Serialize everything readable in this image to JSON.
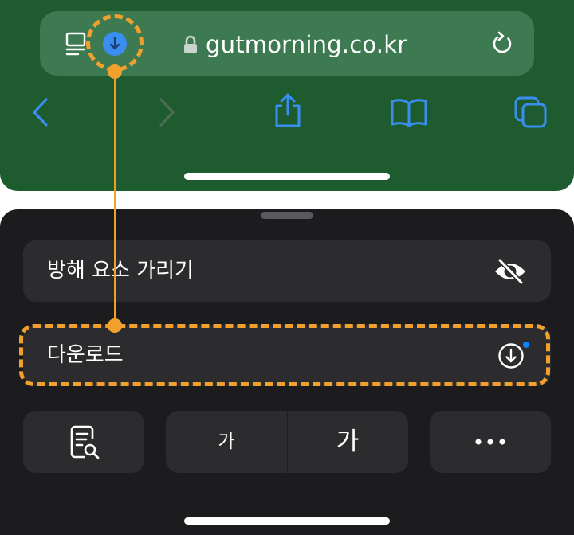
{
  "browser": {
    "url": "gutmorning.co.kr",
    "reader_icon": "page-menu-icon",
    "download_icon": "download-arrow-icon",
    "lock_icon": "lock-icon",
    "reload_icon": "reload-icon"
  },
  "toolbar": {
    "items": [
      "back-icon",
      "forward-icon",
      "share-icon",
      "bookmarks-icon",
      "tabs-icon"
    ]
  },
  "menu": {
    "hide_distracting_items": {
      "label": "방해 요소 가리기",
      "icon": "eye-slash-icon"
    },
    "downloads": {
      "label": "다운로드",
      "icon": "download-circle-icon",
      "has_unread": true
    },
    "actions": {
      "page_report_icon": "document-search-icon",
      "font_smaller": "가",
      "font_larger": "가",
      "more_icon": "ellipsis-icon"
    }
  },
  "colors": {
    "safari_bar": "#1e5c30",
    "address_field": "#3d7a52",
    "accent_blue": "#0a84ff",
    "sheet_bg": "#1c1c1e",
    "card_bg": "#2c2c2e",
    "annotation": "#f1a02d"
  }
}
